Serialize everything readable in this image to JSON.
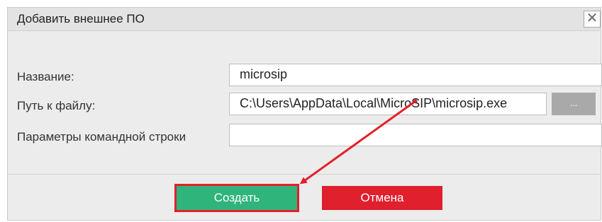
{
  "dialog": {
    "title": "Добавить внешнее ПО",
    "close_glyph": "✕"
  },
  "form": {
    "name_label": "Название:",
    "name_value": "microsip",
    "path_label": "Путь к файлу:",
    "path_value": "C:\\Users\\AppData\\Local\\MicroSIP\\microsip.exe",
    "browse_label": "...",
    "params_label": "Параметры командной строки",
    "params_value": ""
  },
  "buttons": {
    "create_label": "Создать",
    "cancel_label": "Отмена"
  },
  "colors": {
    "create": "#2fb47c",
    "cancel": "#e0202c",
    "annotation": "#e3202a"
  },
  "icons": {
    "close": "close-icon",
    "browse": "ellipsis-icon"
  }
}
